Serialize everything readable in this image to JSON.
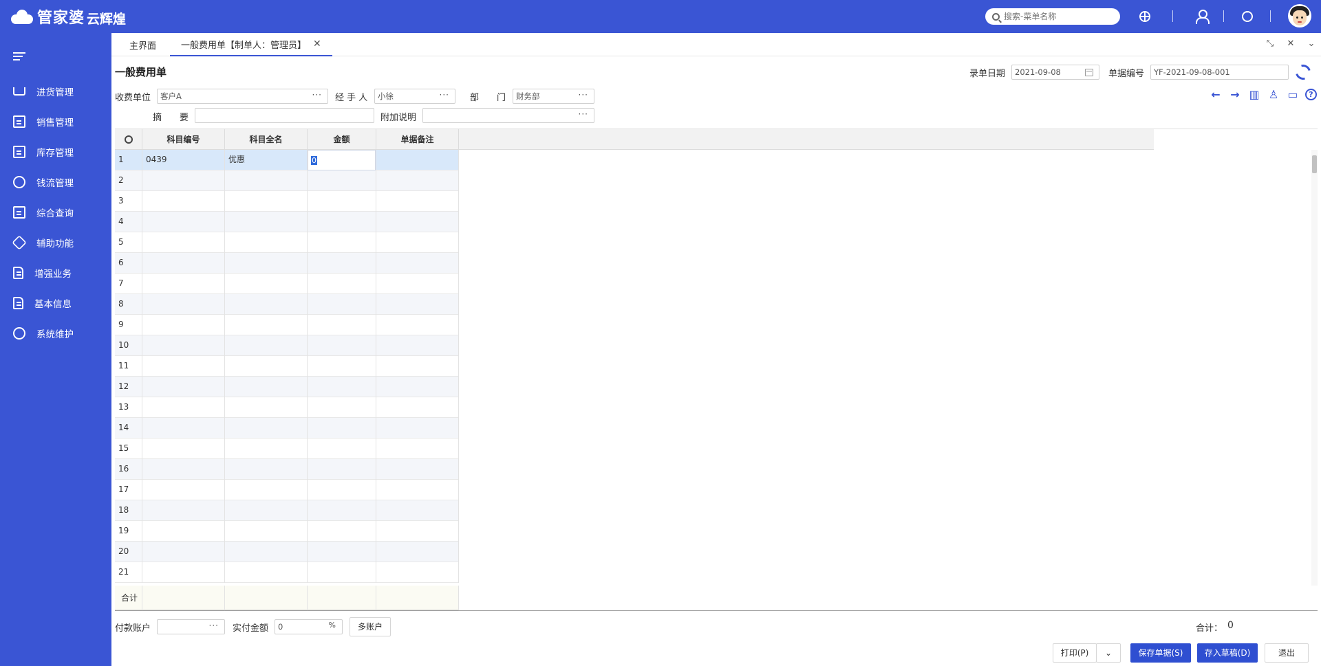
{
  "brand": {
    "name": "管家婆",
    "sub": "云辉煌"
  },
  "search": {
    "placeholder": "搜索-菜单名称"
  },
  "sidebar": {
    "items": [
      {
        "label": "进货管理",
        "icon": "cart-icon"
      },
      {
        "label": "销售管理",
        "icon": "sales-chart-icon"
      },
      {
        "label": "库存管理",
        "icon": "warehouse-box-icon"
      },
      {
        "label": "钱流管理",
        "icon": "money-bag-icon"
      },
      {
        "label": "综合查询",
        "icon": "query-search-icon"
      },
      {
        "label": "辅助功能",
        "icon": "hexagon-tool-icon"
      },
      {
        "label": "增强业务",
        "icon": "enhance-doc-icon"
      },
      {
        "label": "基本信息",
        "icon": "info-doc-icon"
      },
      {
        "label": "系统维护",
        "icon": "handshake-maintenance-icon"
      }
    ]
  },
  "tabs": [
    {
      "label": "主界面"
    },
    {
      "label": "一般费用单【制单人：管理员】"
    }
  ],
  "page": {
    "title": "一般费用单"
  },
  "form": {
    "date_label": "录单日期",
    "date_value": "2021-09-08",
    "docno_label": "单据编号",
    "docno_value": "YF-2021-09-08-001",
    "payee_label": "收费单位",
    "payee_value": "客户A",
    "handler_label": "经 手 人",
    "handler_value": "小徐",
    "dept_label": "部　　门",
    "dept_value": "财务部",
    "summary_label": "摘　　要",
    "summary_value": "",
    "note_label": "附加说明",
    "note_value": ""
  },
  "grid": {
    "columns": [
      "科目编号",
      "科目全名",
      "金额",
      "单据备注"
    ],
    "rows": [
      {
        "no": "1",
        "code": "0439",
        "name": "优惠",
        "amount": "0",
        "remark": ""
      },
      {
        "no": "2"
      },
      {
        "no": "3"
      },
      {
        "no": "4"
      },
      {
        "no": "5"
      },
      {
        "no": "6"
      },
      {
        "no": "7"
      },
      {
        "no": "8"
      },
      {
        "no": "9"
      },
      {
        "no": "10"
      },
      {
        "no": "11"
      },
      {
        "no": "12"
      },
      {
        "no": "13"
      },
      {
        "no": "14"
      },
      {
        "no": "15"
      },
      {
        "no": "16"
      },
      {
        "no": "17"
      },
      {
        "no": "18"
      },
      {
        "no": "19"
      },
      {
        "no": "20"
      },
      {
        "no": "21"
      }
    ],
    "total_label": "合计"
  },
  "footer": {
    "pay_account_label": "付款账户",
    "pay_account_value": "",
    "paid_label": "实付金额",
    "paid_value": "0",
    "multi_account": "多账户",
    "sum_label": "合计：",
    "sum_value": "0",
    "print": "打印(P)",
    "save": "保存单据(S)",
    "draft": "存入草稿(D)",
    "exit": "退出"
  },
  "colors": {
    "brand": "#3a55d4",
    "primary_button": "#2f4fd1",
    "selected_row": "#d8e8fa"
  }
}
